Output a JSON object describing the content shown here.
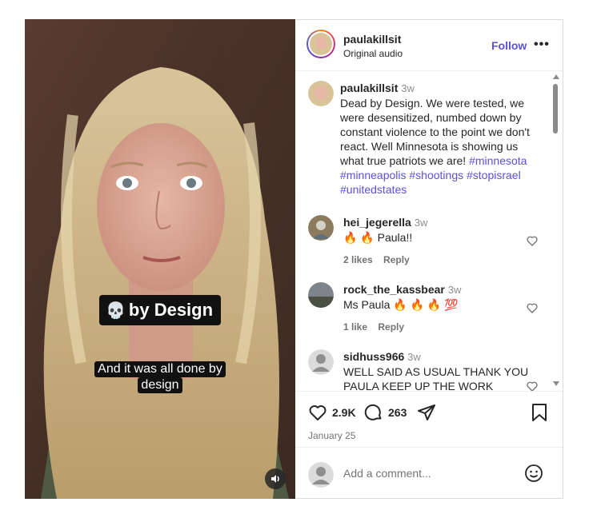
{
  "video": {
    "caption_title": "by Design",
    "caption_title_icon": "skull-icon",
    "subtitle_line1": "And it was all done by",
    "subtitle_line2": "design",
    "mute_icon": "speaker-icon"
  },
  "header": {
    "username": "paulakillsit",
    "audio": "Original audio",
    "follow_label": "Follow",
    "more_label": "•••"
  },
  "caption": {
    "username": "paulakillsit",
    "time": "3w",
    "text": "Dead by Design. We were tested, we were desensitized, numbed down by constant violence to the point we don't react. Well Minnesota is showing us what true patriots we are!",
    "hashtags": [
      "#minnesota",
      "#minneapolis",
      "#shootings",
      "#stopisrael",
      "#unitedstates"
    ]
  },
  "comments": [
    {
      "username": "hei_jegerella",
      "time": "3w",
      "text": "🔥 🔥 Paula!!",
      "likes": "2 likes",
      "reply": "Reply"
    },
    {
      "username": "rock_the_kassbear",
      "time": "3w",
      "text": "Ms Paula 🔥 🔥 🔥 💯",
      "likes": "1 like",
      "reply": "Reply"
    },
    {
      "username": "sidhuss966",
      "time": "3w",
      "text": "WELL SAID AS USUAL THANK YOU PAULA KEEP UP THE WORK THANK",
      "likes": "",
      "reply": ""
    }
  ],
  "actions": {
    "like_count": "2.9K",
    "comment_count": "263",
    "date": "January 25"
  },
  "add_comment": {
    "placeholder": "Add a comment..."
  },
  "colors": {
    "accent": "#5b51d8",
    "muted": "#737373",
    "border": "#dbdbdb"
  }
}
